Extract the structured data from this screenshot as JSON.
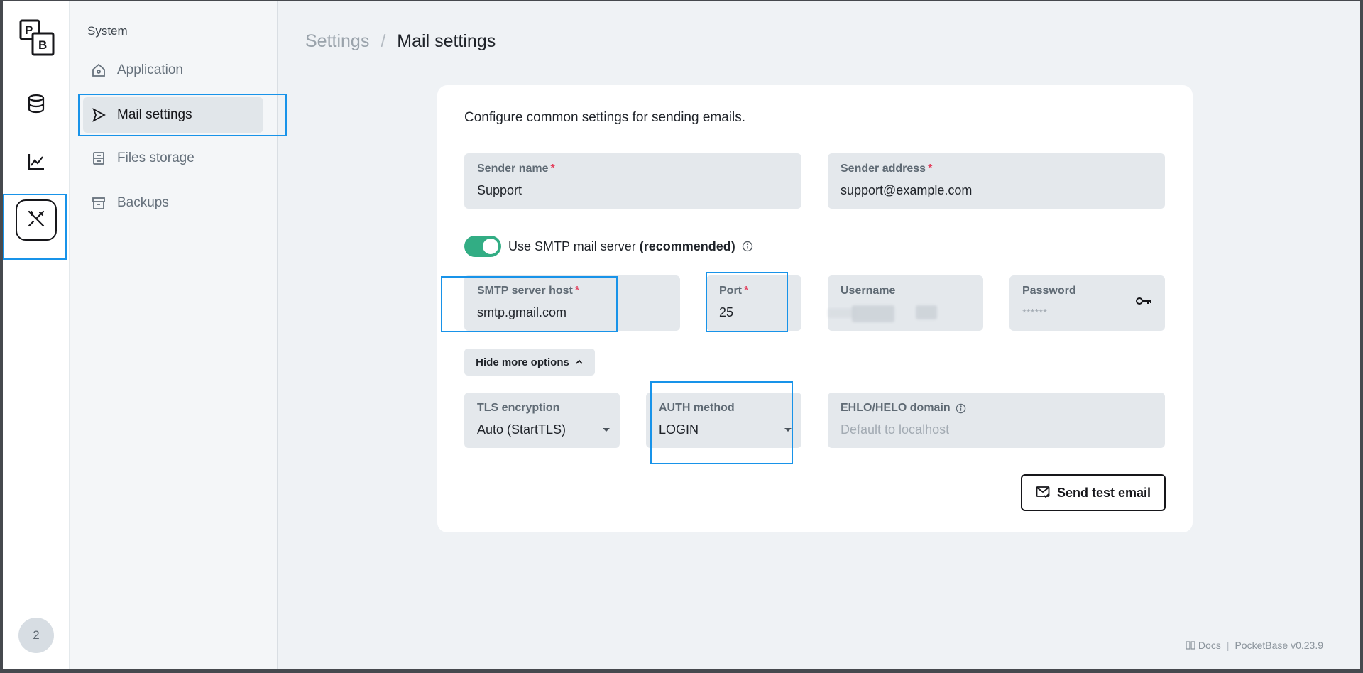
{
  "rail": {
    "logo_letters": [
      "P",
      "B"
    ],
    "items": [
      {
        "name": "collections",
        "icon": "database-icon"
      },
      {
        "name": "logs",
        "icon": "chart-line-icon"
      },
      {
        "name": "settings",
        "icon": "tools-icon",
        "active": true
      }
    ],
    "avatar_text": "2"
  },
  "subnav": {
    "title": "System",
    "items": [
      {
        "label": "Application",
        "icon": "home-icon"
      },
      {
        "label": "Mail settings",
        "icon": "send-icon",
        "active": true
      },
      {
        "label": "Files storage",
        "icon": "storage-icon"
      },
      {
        "label": "Backups",
        "icon": "archive-icon"
      }
    ]
  },
  "breadcrumb": {
    "parent": "Settings",
    "separator": "/",
    "current": "Mail settings"
  },
  "form": {
    "intro": "Configure common settings for sending emails.",
    "sender_name": {
      "label": "Sender name",
      "required": "*",
      "value": "Support"
    },
    "sender_address": {
      "label": "Sender address",
      "required": "*",
      "value": "support@example.com"
    },
    "smtp_toggle": {
      "label": "Use SMTP mail server",
      "emphasis": "(recommended)",
      "enabled": true
    },
    "smtp_host": {
      "label": "SMTP server host",
      "required": "*",
      "value": "smtp.gmail.com"
    },
    "port": {
      "label": "Port",
      "required": "*",
      "value": "25"
    },
    "username": {
      "label": "Username",
      "value": ""
    },
    "password": {
      "label": "Password",
      "placeholder": "******"
    },
    "more_options_label": "Hide more options",
    "tls": {
      "label": "TLS encryption",
      "value": "Auto (StartTLS)"
    },
    "auth": {
      "label": "AUTH method",
      "value": "LOGIN"
    },
    "ehlo": {
      "label": "EHLO/HELO domain",
      "placeholder": "Default to localhost"
    },
    "send_test_label": "Send test email"
  },
  "footer": {
    "docs": "Docs",
    "separator": "|",
    "version": "PocketBase v0.23.9"
  },
  "colors": {
    "accent_toggle": "#32ad84",
    "required": "#e34562",
    "highlight": "#1893e9"
  }
}
